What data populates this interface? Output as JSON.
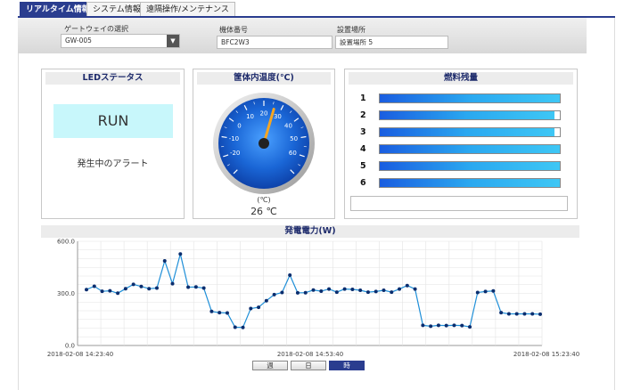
{
  "tabs": [
    {
      "label": "リアルタイム情報",
      "active": true
    },
    {
      "label": "システム情報",
      "active": false
    },
    {
      "label": "遠隔操作/メンテナンス",
      "active": false
    }
  ],
  "form": {
    "gateway_label": "ゲートウェイの選択",
    "gateway_value": "GW-005",
    "machine_label": "機体番号",
    "machine_value": "BFC2W3",
    "location_label": "設置場所",
    "location_value": "設置場所 5"
  },
  "led": {
    "title": "LEDステータス",
    "status": "RUN",
    "alert": "発生中のアラート"
  },
  "temperature": {
    "title": "筐体内温度(℃)",
    "gauge_unit": "(℃)",
    "value_text": "26 ℃",
    "value": 26,
    "min": -30,
    "max": 70,
    "ticks": [
      "-20",
      "-10",
      "0",
      "10",
      "20",
      "30",
      "40",
      "50",
      "60"
    ]
  },
  "fuel": {
    "title": "燃料残量",
    "rows": [
      {
        "label": "1",
        "level": 1.0
      },
      {
        "label": "2",
        "level": 0.97
      },
      {
        "label": "3",
        "level": 0.97
      },
      {
        "label": "4",
        "level": 1.0
      },
      {
        "label": "5",
        "level": 1.0
      },
      {
        "label": "6",
        "level": 1.0
      }
    ]
  },
  "power": {
    "title": "発電電力(W)",
    "toggles": [
      {
        "label": "週",
        "active": false
      },
      {
        "label": "日",
        "active": false
      },
      {
        "label": "時",
        "active": true
      }
    ]
  },
  "colors": {
    "tab_active": "#2a3d8f",
    "title_text": "#1d2a6b",
    "led_run_bg": "#c8f7fb",
    "series": "#1f8fd8",
    "marker": "#0a2d6e"
  },
  "chart_data": {
    "type": "line",
    "ylim": [
      0,
      600
    ],
    "yticks": [
      "0.0",
      "300.0",
      "600.0"
    ],
    "xticks": [
      "2018-02-08 14:23:40",
      "2018-02-08 14:53:40",
      "2018-02-08 15:23:40"
    ],
    "grid": true,
    "values": [
      322,
      341,
      312,
      315,
      301,
      327,
      352,
      340,
      327,
      331,
      487,
      356,
      527,
      336,
      337,
      331,
      196,
      189,
      187,
      105,
      104,
      213,
      220,
      258,
      293,
      305,
      405,
      303,
      304,
      319,
      313,
      325,
      307,
      325,
      323,
      318,
      307,
      311,
      318,
      307,
      325,
      345,
      325,
      116,
      111,
      116,
      115,
      116,
      115,
      107,
      305,
      311,
      314,
      189,
      182,
      182,
      182,
      182,
      180
    ]
  }
}
